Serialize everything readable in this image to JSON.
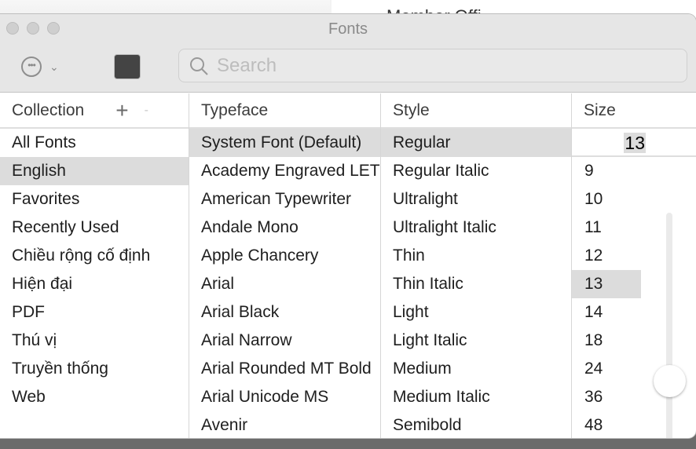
{
  "background": {
    "text": "Member Offi"
  },
  "window": {
    "title": "Fonts"
  },
  "toolbar": {
    "actions_icon": "ellipsis-circle-icon",
    "color_swatch": "#444444",
    "search_placeholder": "Search"
  },
  "columns": {
    "collection": {
      "header": "Collection",
      "add": "+",
      "remove": "-",
      "items": [
        "All Fonts",
        "English",
        "Favorites",
        "Recently Used",
        "Chiều rộng cố định",
        "Hiện đại",
        "PDF",
        "Thú vị",
        "Truyền thống",
        "Web"
      ],
      "selected": 1
    },
    "typeface": {
      "header": "Typeface",
      "items": [
        "System Font (Default)",
        "Academy Engraved LET",
        "American Typewriter",
        "Andale Mono",
        "Apple Chancery",
        "Arial",
        "Arial Black",
        "Arial Narrow",
        "Arial Rounded MT Bold",
        "Arial Unicode MS",
        "Avenir"
      ],
      "selected": 0
    },
    "style": {
      "header": "Style",
      "items": [
        "Regular",
        "Regular Italic",
        "Ultralight",
        "Ultralight Italic",
        "Thin",
        "Thin Italic",
        "Light",
        "Light Italic",
        "Medium",
        "Medium Italic",
        "Semibold"
      ],
      "selected": 0
    },
    "size": {
      "header": "Size",
      "value": "13",
      "items": [
        "9",
        "10",
        "11",
        "12",
        "13",
        "14",
        "18",
        "24",
        "36",
        "48"
      ],
      "selected": 4
    }
  }
}
